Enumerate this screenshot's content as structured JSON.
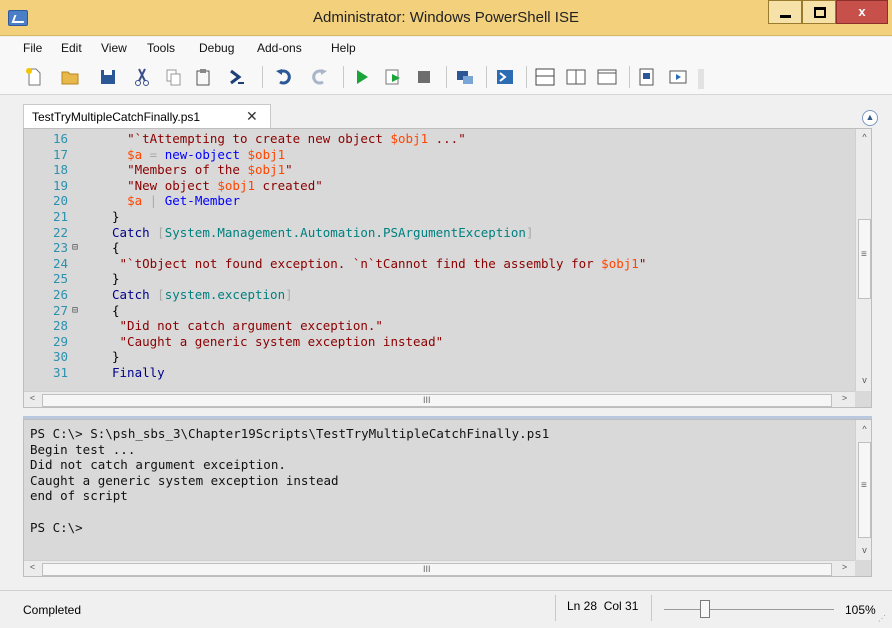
{
  "window": {
    "title": "Administrator: Windows PowerShell ISE",
    "close_glyph": "x",
    "icons": [
      "powershell-ise-icon",
      "minimize-icon",
      "maximize-icon",
      "close-icon"
    ]
  },
  "menu": [
    "File",
    "Edit",
    "View",
    "Tools",
    "Debug",
    "Add-ons",
    "Help"
  ],
  "toolbar": {
    "icons": [
      "new-script-icon",
      "open-icon",
      "save-icon",
      "cut-icon",
      "copy-icon",
      "paste-icon",
      "clear-console-icon",
      "undo-icon",
      "redo-icon",
      "run-script-icon",
      "run-selection-icon",
      "stop-icon",
      "new-remote-tab-icon",
      "powershell-icon",
      "show-script-top-icon",
      "show-script-right-icon",
      "show-script-maximized-icon",
      "show-command-window-icon",
      "show-addon-icon"
    ]
  },
  "tab": {
    "label": "TestTryMultipleCatchFinally.ps1",
    "close": "✕",
    "collapse": "▲"
  },
  "script": {
    "lines": [
      {
        "num": "16",
        "fold": "",
        "html": "<span class=\"s\">\"`tAttempting to create new object </span><span class=\"v\">$obj1</span><span class=\"s\"> ...\"</span>",
        "indent": "  "
      },
      {
        "num": "17",
        "fold": "",
        "html": "<span class=\"v\">$a</span> <span class=\"o\">=</span> <span class=\"c\">new-object</span> <span class=\"v\">$obj1</span>",
        "indent": "  "
      },
      {
        "num": "18",
        "fold": "",
        "html": "<span class=\"s\">\"Members of the </span><span class=\"v\">$obj1</span><span class=\"s\">\"</span>",
        "indent": "  "
      },
      {
        "num": "19",
        "fold": "",
        "html": "<span class=\"s\">\"New object </span><span class=\"v\">$obj1</span><span class=\"s\"> created\"</span>",
        "indent": "  "
      },
      {
        "num": "20",
        "fold": "",
        "html": "<span class=\"v\">$a</span> <span class=\"o\">|</span> <span class=\"c\">Get-Member</span>",
        "indent": "  "
      },
      {
        "num": "21",
        "fold": "",
        "html": "}",
        "indent": ""
      },
      {
        "num": "22",
        "fold": "",
        "html": "<span class=\"k\">Catch</span> <span class=\"o\">[</span><span class=\"t\">System.Management.Automation.PSArgumentException</span><span class=\"o\">]</span>",
        "indent": ""
      },
      {
        "num": "23",
        "fold": "⊟",
        "html": "{",
        "indent": ""
      },
      {
        "num": "24",
        "fold": "",
        "html": "<span class=\"s\">\"`tObject not found exception. `n`tCannot find the assembly for </span><span class=\"v\">$obj1</span><span class=\"s\">\"</span>",
        "indent": " "
      },
      {
        "num": "25",
        "fold": "",
        "html": "}",
        "indent": ""
      },
      {
        "num": "26",
        "fold": "",
        "html": "<span class=\"k\">Catch</span> <span class=\"o\">[</span><span class=\"t\">system.exception</span><span class=\"o\">]</span>",
        "indent": ""
      },
      {
        "num": "27",
        "fold": "⊟",
        "html": "{",
        "indent": ""
      },
      {
        "num": "28",
        "fold": "",
        "html": "<span class=\"s\">\"Did not catch argument exception.\"</span>",
        "indent": " "
      },
      {
        "num": "29",
        "fold": "",
        "html": "<span class=\"s\">\"Caught a generic system exception instead\"</span>",
        "indent": " "
      },
      {
        "num": "30",
        "fold": "",
        "html": "}",
        "indent": ""
      },
      {
        "num": "31",
        "fold": "",
        "html": "<span class=\"k\">Finally</span>",
        "indent": ""
      }
    ]
  },
  "console": {
    "lines": [
      "PS C:\\> S:\\psh_sbs_3\\Chapter19Scripts\\TestTryMultipleCatchFinally.ps1",
      "Begin test ...",
      "Did not catch argument exceiption.",
      "Caught a generic system exception instead",
      "end of script",
      "",
      "PS C:\\>"
    ]
  },
  "scroll": {
    "up": "^",
    "down": "v",
    "left": "<",
    "right": ">",
    "grip": "≡",
    "hgrip": "III"
  },
  "status": {
    "text": "Completed",
    "position": "Ln 28  Col 31",
    "zoom": "105%",
    "grip": "⋰"
  }
}
